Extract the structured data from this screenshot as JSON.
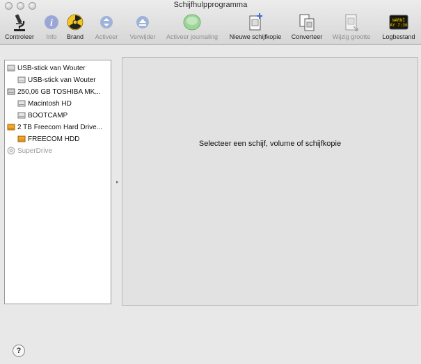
{
  "window": {
    "title": "Schijfhulpprogramma"
  },
  "toolbar": {
    "verify": "Controleer",
    "info": "Info",
    "burn": "Brand",
    "activate": "Activeer",
    "eject": "Verwijder",
    "journaling": "Activeer journaling",
    "new_image": "Nieuwe schijfkopie",
    "convert": "Converteer",
    "resize": "Wijzig grootte",
    "log": "Logbestand",
    "log_screen_text": "WARNI\nAY 7:36"
  },
  "sidebar": {
    "disks": [
      {
        "label": "USB-stick van Wouter",
        "icon": "usb-disk-icon"
      },
      {
        "label": "USB-stick van Wouter",
        "icon": "volume-icon"
      },
      {
        "label": "250,06 GB TOSHIBA MK...",
        "icon": "internal-disk-icon"
      },
      {
        "label": "Macintosh HD",
        "icon": "volume-icon"
      },
      {
        "label": "BOOTCAMP",
        "icon": "volume-icon"
      },
      {
        "label": "2 TB Freecom Hard Drive...",
        "icon": "external-disk-icon"
      },
      {
        "label": "FREECOM HDD",
        "icon": "external-volume-icon"
      },
      {
        "label": "SuperDrive",
        "icon": "optical-drive-icon"
      }
    ]
  },
  "main": {
    "message": "Selecteer een schijf, volume of schijfkopie"
  },
  "help": {
    "label": "?"
  }
}
